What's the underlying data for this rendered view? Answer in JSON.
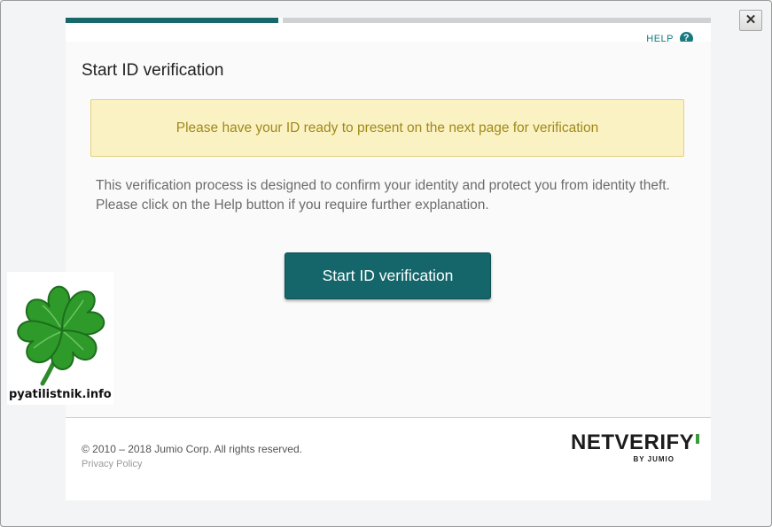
{
  "dialog": {
    "progress": {
      "current_step": 1,
      "total_steps": 2,
      "fraction": 0.33
    },
    "help_label": "HELP",
    "help_icon_glyph": "?",
    "close_glyph": "✕",
    "title": "Start ID verification",
    "notice": "Please have your ID ready to present on the next page for verification",
    "description": "This verification process is designed to confirm your identity and protect you from identity theft. Please click on the Help button if you require further explanation.",
    "start_button_label": "Start ID verification"
  },
  "footer": {
    "copyright": "© 2010 – 2018 Jumio Corp. All rights reserved.",
    "privacy_link": "Privacy Policy",
    "brand_name": "NETVERIFY",
    "brand_sub": "BY JUMIO"
  },
  "watermark": {
    "text": "pyatilistnik.info",
    "icon": "four-leaf-clover-icon"
  },
  "colors": {
    "accent_teal": "#15666b",
    "notice_bg": "#fbf2c4",
    "notice_text": "#9e8a1c",
    "brand_green": "#3a9a3e"
  }
}
